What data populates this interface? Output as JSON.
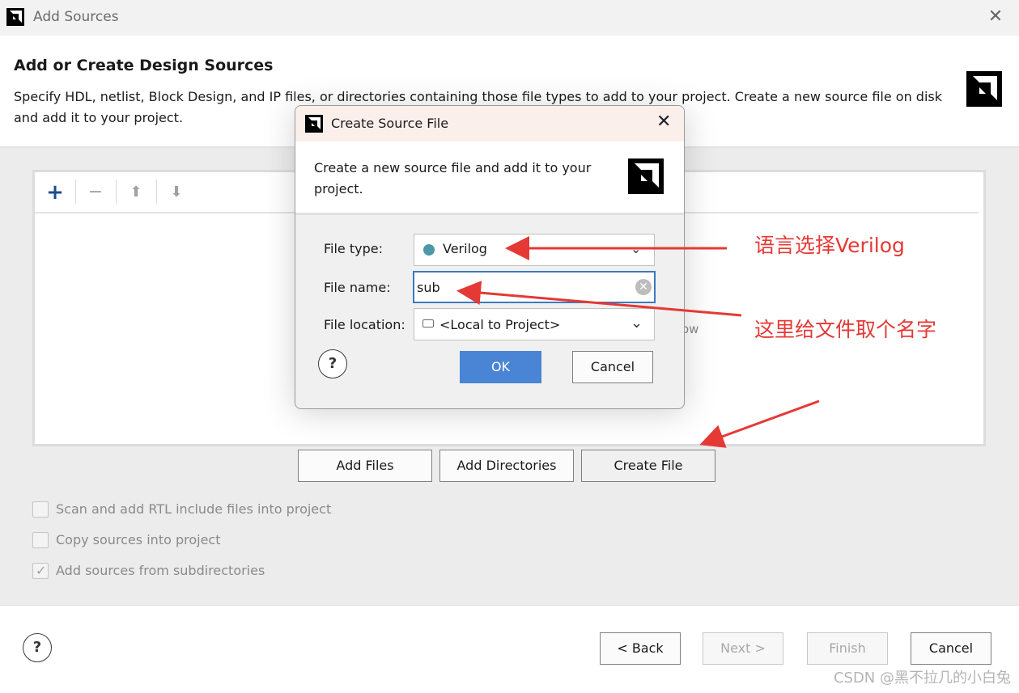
{
  "window": {
    "title": "Add Sources",
    "close_label": "✕"
  },
  "header": {
    "title": "Add or Create Design Sources",
    "description": "Specify HDL, netlist, Block Design, and IP files, or directories containing those file types to add to your project. Create a new source file on disk and add it to your project."
  },
  "toolbar": {
    "add": "+",
    "remove": "−",
    "up": "⬆",
    "down": "⬇"
  },
  "panel": {
    "hint_fragment": "ow"
  },
  "actions": {
    "add_files": "Add Files",
    "add_directories": "Add Directories",
    "create_file": "Create File"
  },
  "options": [
    {
      "label": "Scan and add RTL include files into project",
      "checked": false
    },
    {
      "label": "Copy sources into project",
      "checked": false
    },
    {
      "label": "Add sources from subdirectories",
      "checked": true
    }
  ],
  "footer": {
    "help": "?",
    "back": "< Back",
    "next": "Next >",
    "finish": "Finish",
    "cancel": "Cancel"
  },
  "dialog": {
    "title": "Create Source File",
    "close_label": "✕",
    "description": "Create a new source file and add it to your project.",
    "file_type_label": "File type:",
    "file_type_value": "Verilog",
    "file_name_label": "File name:",
    "file_name_value": "sub",
    "file_location_label": "File location:",
    "file_location_value": "<Local to Project>",
    "help": "?",
    "ok": "OK",
    "cancel": "Cancel",
    "verilog_dot_color": "#4a98a8"
  },
  "annotations": {
    "language_note": "语言选择Verilog",
    "name_note": "这里给文件取个名字",
    "color": "#e53935"
  },
  "watermark": "CSDN @黑不拉几的小白兔"
}
